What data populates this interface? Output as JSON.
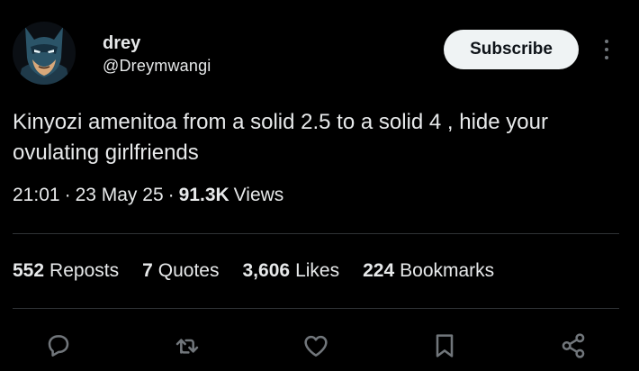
{
  "author": {
    "display_name": "drey",
    "handle": "@Dreymwangi"
  },
  "subscribe_label": "Subscribe",
  "post": {
    "text": "Kinyozi amenitoa from a solid 2.5 to a solid 4 , hide your ovulating girlfriends",
    "time": "21:01",
    "date": "23 May 25",
    "separator": "·",
    "views_count": "91.3K",
    "views_label": "Views"
  },
  "stats": [
    {
      "count": "552",
      "label": "Reposts"
    },
    {
      "count": "7",
      "label": "Quotes"
    },
    {
      "count": "3,606",
      "label": "Likes"
    },
    {
      "count": "224",
      "label": "Bookmarks"
    }
  ],
  "actions": [
    "reply-icon",
    "repost-icon",
    "like-icon",
    "bookmark-icon",
    "share-icon"
  ],
  "colors": {
    "background": "#000000",
    "text": "#e7e9ea",
    "muted": "#71767b",
    "divider": "#2f3336",
    "button_bg": "#eff3f4",
    "button_text": "#0f1419"
  }
}
